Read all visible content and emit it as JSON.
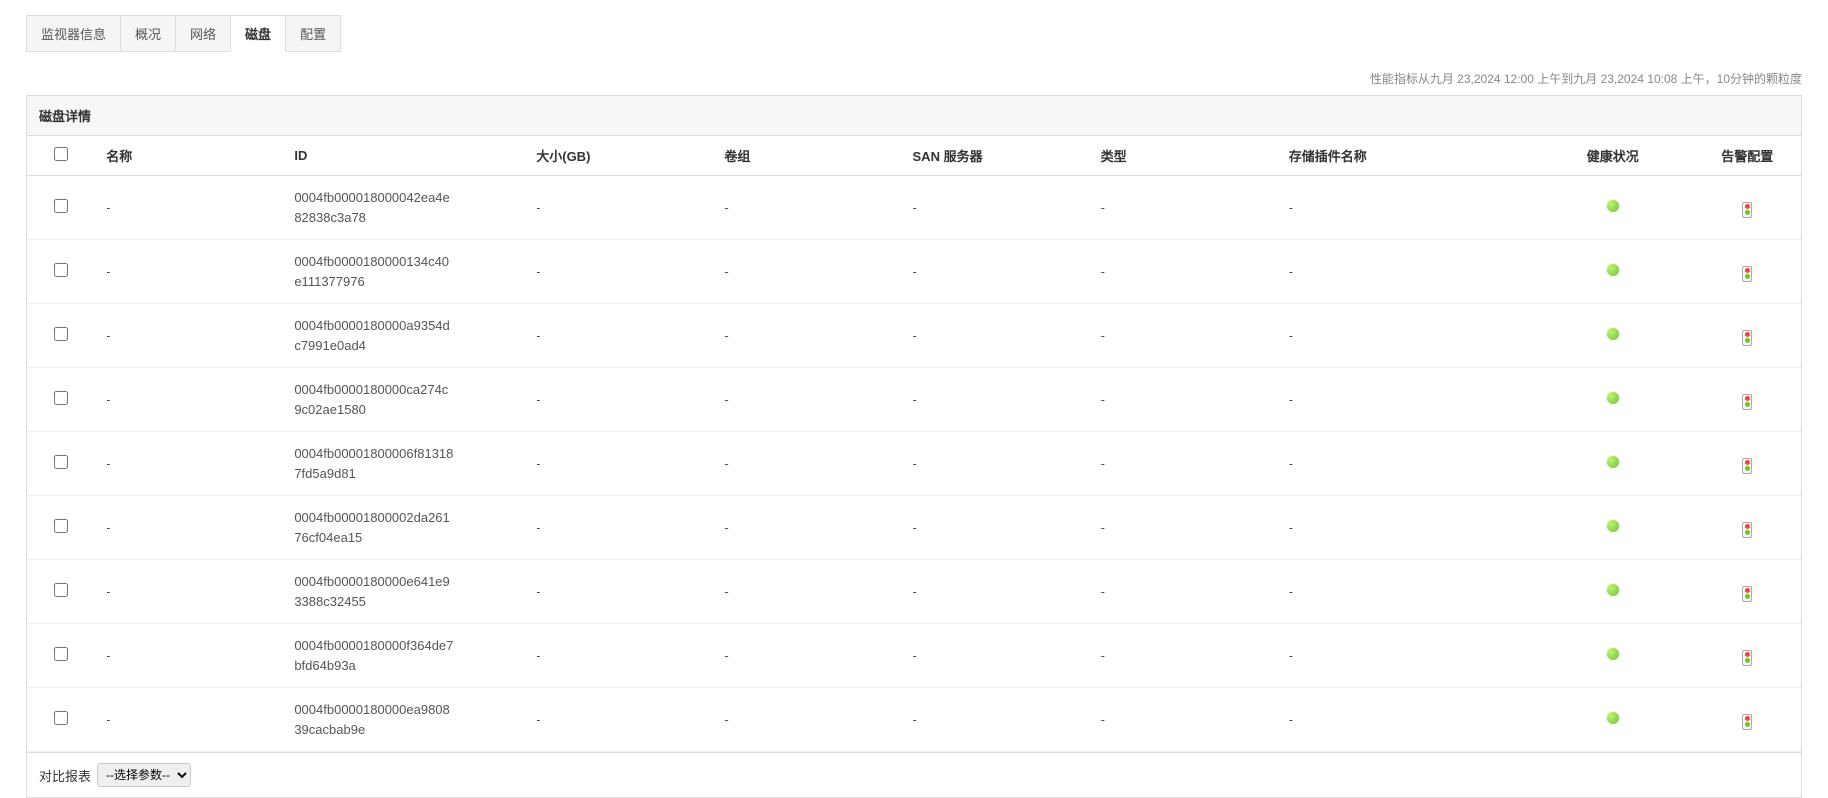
{
  "tabs": [
    {
      "label": "监视器信息",
      "active": false
    },
    {
      "label": "概况",
      "active": false
    },
    {
      "label": "网络",
      "active": false
    },
    {
      "label": "磁盘",
      "active": true
    },
    {
      "label": "配置",
      "active": false
    }
  ],
  "metricsInfo": "性能指标从九月 23,2024 12:00 上午到九月 23,2024 10:08 上午，10分钟的颗粒度",
  "panel": {
    "title": "磁盘详情",
    "columns": {
      "name": "名称",
      "id": "ID",
      "size": "大小(GB)",
      "vg": "卷组",
      "san": "SAN 服务器",
      "type": "类型",
      "plugin": "存储插件名称",
      "health": "健康状况",
      "alarm": "告警配置"
    },
    "rows": [
      {
        "name": "-",
        "id": "0004fb000018000042ea4e82838c3a78",
        "size": "-",
        "vg": "-",
        "san": "-",
        "type": "-",
        "plugin": "-"
      },
      {
        "name": "-",
        "id": "0004fb0000180000134c40e111377976",
        "size": "-",
        "vg": "-",
        "san": "-",
        "type": "-",
        "plugin": "-"
      },
      {
        "name": "-",
        "id": "0004fb0000180000a9354dc7991e0ad4",
        "size": "-",
        "vg": "-",
        "san": "-",
        "type": "-",
        "plugin": "-"
      },
      {
        "name": "-",
        "id": "0004fb0000180000ca274c9c02ae1580",
        "size": "-",
        "vg": "-",
        "san": "-",
        "type": "-",
        "plugin": "-"
      },
      {
        "name": "-",
        "id": "0004fb00001800006f813187fd5a9d81",
        "size": "-",
        "vg": "-",
        "san": "-",
        "type": "-",
        "plugin": "-"
      },
      {
        "name": "-",
        "id": "0004fb00001800002da26176cf04ea15",
        "size": "-",
        "vg": "-",
        "san": "-",
        "type": "-",
        "plugin": "-"
      },
      {
        "name": "-",
        "id": "0004fb0000180000e641e93388c32455",
        "size": "-",
        "vg": "-",
        "san": "-",
        "type": "-",
        "plugin": "-"
      },
      {
        "name": "-",
        "id": "0004fb0000180000f364de7bfd64b93a",
        "size": "-",
        "vg": "-",
        "san": "-",
        "type": "-",
        "plugin": "-"
      },
      {
        "name": "-",
        "id": "0004fb0000180000ea980839cacbab9e",
        "size": "-",
        "vg": "-",
        "san": "-",
        "type": "-",
        "plugin": "-"
      }
    ]
  },
  "footer": {
    "compareLabel": "对比报表",
    "selectPlaceholder": "--选择参数--"
  }
}
